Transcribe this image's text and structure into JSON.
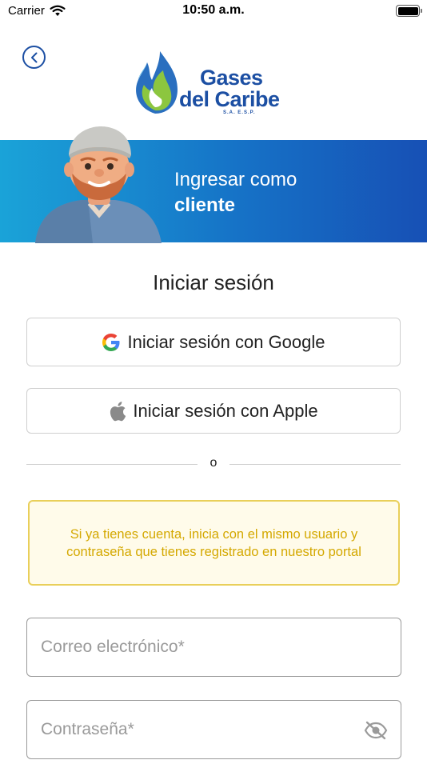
{
  "status_bar": {
    "carrier": "Carrier",
    "time": "10:50 a.m."
  },
  "logo": {
    "line1": "Gases",
    "line2": "del Caribe",
    "sub": "S.A. E.S.P."
  },
  "banner": {
    "line1": "Ingresar como",
    "line2": "cliente"
  },
  "login": {
    "title": "Iniciar sesión",
    "google_label": "Iniciar sesión con Google",
    "apple_label": "Iniciar sesión con Apple",
    "divider_text": "o",
    "notice": "Si ya tienes cuenta, inicia con el mismo usuario y contraseña que tienes registrado en nuestro portal",
    "email_placeholder": "Correo electrónico*",
    "password_placeholder": "Contraseña*"
  },
  "colors": {
    "brand_blue": "#1c4fa3",
    "banner_start": "#1aa3d8",
    "banner_end": "#1750b5",
    "notice_text": "#d4a800",
    "notice_border": "#e9cf5a",
    "notice_bg": "#fffbea"
  },
  "icons": {
    "back": "chevron-left-circle-icon",
    "google": "google-icon",
    "apple": "apple-icon",
    "password_toggle": "eye-off-icon",
    "wifi": "wifi-icon",
    "battery": "battery-icon"
  }
}
